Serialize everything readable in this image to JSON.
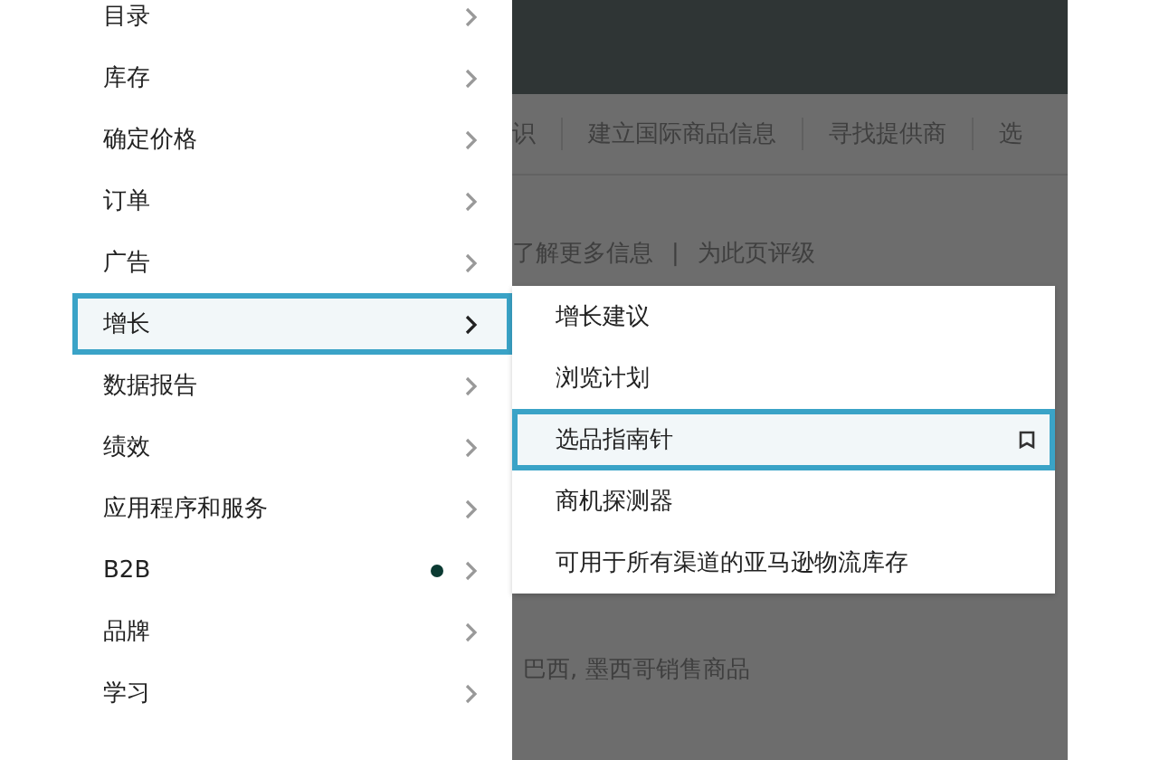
{
  "menu": {
    "items": [
      {
        "label": "目录",
        "selected": false,
        "dot": false
      },
      {
        "label": "库存",
        "selected": false,
        "dot": false
      },
      {
        "label": "确定价格",
        "selected": false,
        "dot": false
      },
      {
        "label": "订单",
        "selected": false,
        "dot": false
      },
      {
        "label": "广告",
        "selected": false,
        "dot": false
      },
      {
        "label": "增长",
        "selected": true,
        "dot": false
      },
      {
        "label": "数据报告",
        "selected": false,
        "dot": false
      },
      {
        "label": "绩效",
        "selected": false,
        "dot": false
      },
      {
        "label": "应用程序和服务",
        "selected": false,
        "dot": false
      },
      {
        "label": "B2B",
        "selected": false,
        "dot": true
      },
      {
        "label": "品牌",
        "selected": false,
        "dot": false
      },
      {
        "label": "学习",
        "selected": false,
        "dot": false
      }
    ]
  },
  "submenu": {
    "items": [
      {
        "label": "增长建议",
        "selected": false
      },
      {
        "label": "浏览计划",
        "selected": false
      },
      {
        "label": "选品指南针",
        "selected": true
      },
      {
        "label": "商机探测器",
        "selected": false
      },
      {
        "label": "可用于所有渠道的亚马逊物流库存",
        "selected": false
      }
    ]
  },
  "page": {
    "nav_links": [
      "识",
      "建立国际商品信息",
      "寻找提供商",
      "选"
    ],
    "help_links": [
      "了解更多信息",
      "为此页评级"
    ],
    "help_separator": "|",
    "body_text": "巴西, 墨西哥销售商品"
  }
}
